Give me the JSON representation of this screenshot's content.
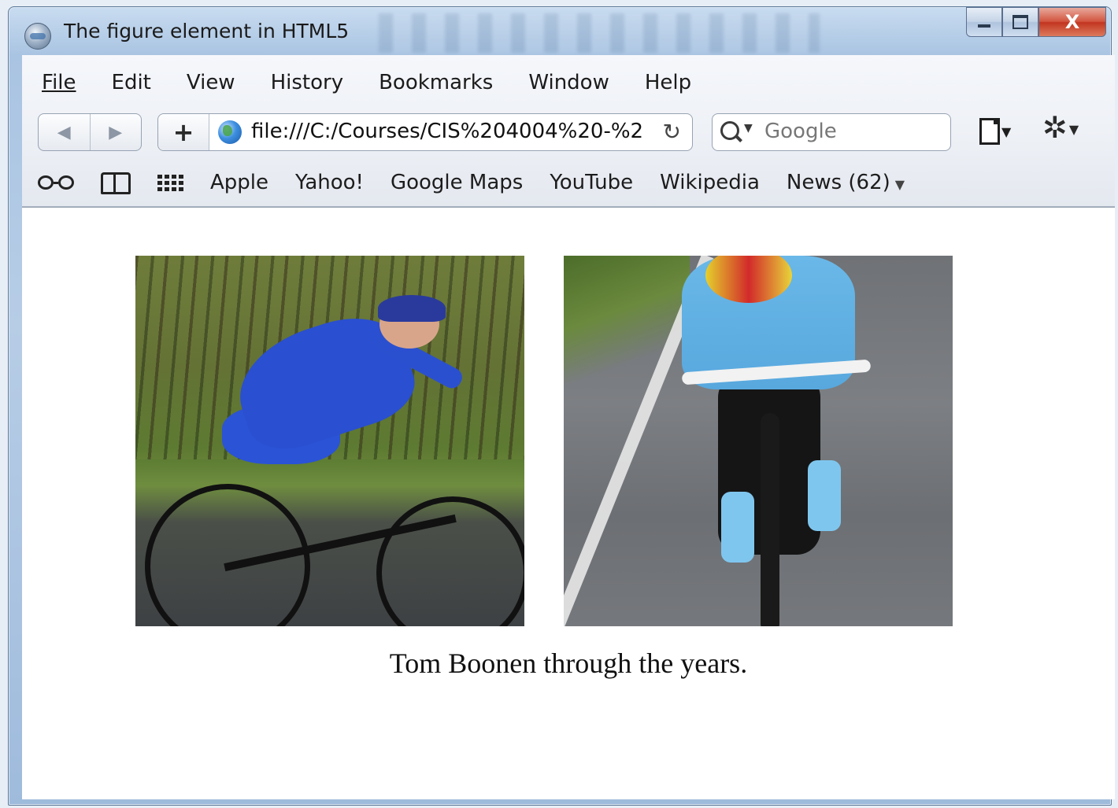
{
  "window": {
    "title": "The figure element in HTML5",
    "controls": {
      "minimize_icon": "minimize-icon",
      "maximize_icon": "maximize-icon",
      "close_label": "X"
    }
  },
  "menu": {
    "items": [
      {
        "label": "File"
      },
      {
        "label": "Edit"
      },
      {
        "label": "View"
      },
      {
        "label": "History"
      },
      {
        "label": "Bookmarks"
      },
      {
        "label": "Window"
      },
      {
        "label": "Help"
      }
    ]
  },
  "toolbar": {
    "back_glyph": "◀",
    "forward_glyph": "▶",
    "add_glyph": "+",
    "url": "file:///C:/Courses/CIS%204004%20-%2",
    "reload_glyph": "↻",
    "search_placeholder": "Google",
    "gear_glyph": "✲"
  },
  "bookmarks": {
    "items": [
      {
        "label": "Apple"
      },
      {
        "label": "Yahoo!"
      },
      {
        "label": "Google Maps"
      },
      {
        "label": "YouTube"
      },
      {
        "label": "Wikipedia"
      },
      {
        "label": "News (62)"
      }
    ],
    "more_glyph": "▼"
  },
  "page": {
    "images": [
      {
        "icon": "cyclist-photo-1"
      },
      {
        "icon": "cyclist-photo-2"
      }
    ],
    "caption": "Tom Boonen through the years."
  }
}
